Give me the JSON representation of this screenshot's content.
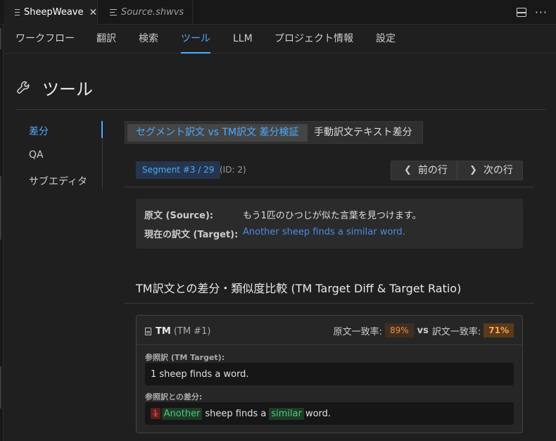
{
  "tabs": [
    {
      "label": "SheepWeave",
      "active": true
    },
    {
      "label": "Source.shwvs",
      "active": false
    }
  ],
  "nav": [
    "ワークフロー",
    "翻訳",
    "検索",
    "ツール",
    "LLM",
    "プロジェクト情報",
    "設定"
  ],
  "nav_active": "ツール",
  "page": {
    "title": "ツール",
    "icon": "wrench-icon"
  },
  "side_menu": [
    "差分",
    "QA",
    "サブエディタ"
  ],
  "subtabs": [
    "セグメント訳文 vs TM訳文 差分検証",
    "手動訳文テキスト差分"
  ],
  "segment": {
    "badge": "Segment #3 / 29",
    "id": "(ID: 2)",
    "prev": "前の行",
    "next": "次の行"
  },
  "st": {
    "source_label": "原文 (Source):",
    "source_value": "もう1匹のひつじが似た言葉を見つけます。",
    "target_label": "現在の訳文 (Target):",
    "target_value": "Another sheep finds a similar word."
  },
  "section_title": "TM訳文との差分・類似度比較 (TM Target Diff & Target Ratio)",
  "tm": {
    "name": "TM",
    "num": "(TM #1)",
    "src_ratio_label": "原文一致率:",
    "src_ratio": "89%",
    "vs": "vs",
    "tgt_ratio_label": "訳文一致率:",
    "tgt_ratio": "71%",
    "ref_label": "参照訳 (TM Target):",
    "ref_value": "1 sheep finds a word.",
    "diff_label": "参照訳との差分:",
    "diff": {
      "del1": "1",
      "ins1": "Another",
      "eq1": "sheep finds a",
      "ins2": "similar",
      "eq2": "word."
    }
  },
  "colors": {
    "accent": "#4daafc",
    "target_text": "#4d8ae6",
    "ratio": "#f0913a",
    "insert": "#4ec97a",
    "delete": "#f14c4c"
  }
}
